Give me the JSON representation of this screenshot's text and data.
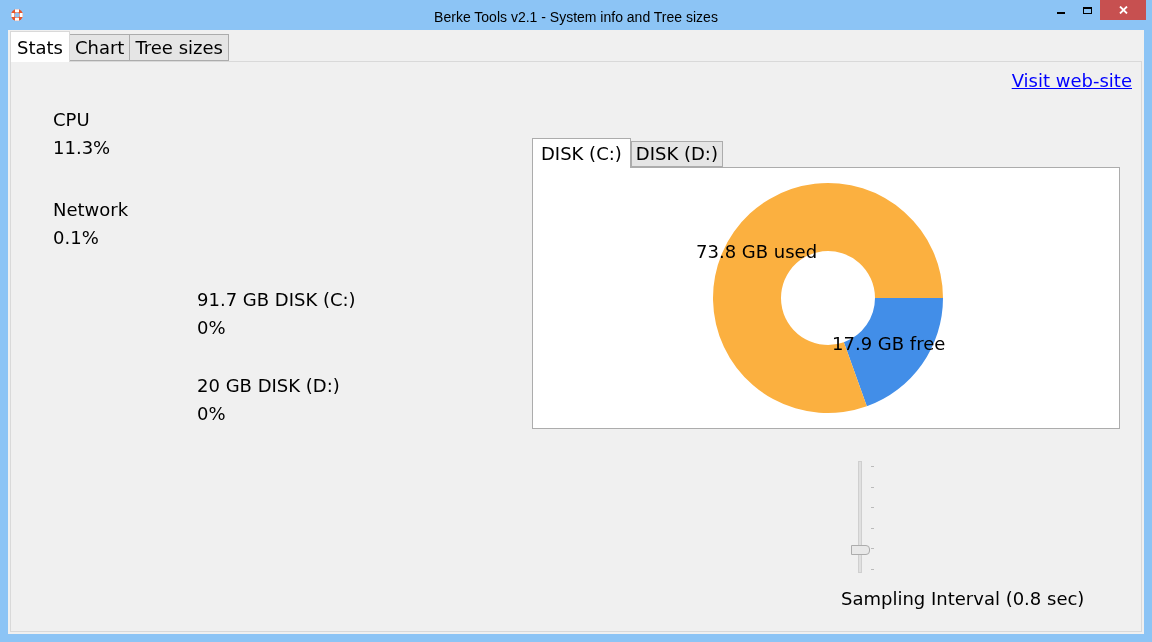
{
  "window": {
    "title": "Berke Tools v2.1 - System info and Tree sizes"
  },
  "tabs": [
    {
      "label": "Stats",
      "selected": true
    },
    {
      "label": "Chart",
      "selected": false
    },
    {
      "label": "Tree sizes",
      "selected": false
    }
  ],
  "link": "Visit web-site",
  "stats": [
    {
      "label": "CPU",
      "value": "11.3%",
      "kind": "main"
    },
    {
      "label": "Network",
      "value": "0.1%",
      "kind": "main"
    },
    {
      "label": "91.7 GB DISK (C:)",
      "value": "0%",
      "kind": "disk"
    },
    {
      "label": "20 GB DISK (D:)",
      "value": "0%",
      "kind": "disk"
    }
  ],
  "disk_tabs": [
    {
      "label": "DISK (C:)",
      "selected": true
    },
    {
      "label": "DISK (D:)",
      "selected": false
    }
  ],
  "chart_data": {
    "type": "donut",
    "categories": [
      "73.8 GB used",
      "17.9 GB free"
    ],
    "values": [
      73.8,
      17.9
    ],
    "colors": [
      "#fbb040",
      "#428ee8"
    ]
  },
  "slider": {
    "level": 0.2,
    "label": "Sampling Interval (0.8 sec)"
  }
}
